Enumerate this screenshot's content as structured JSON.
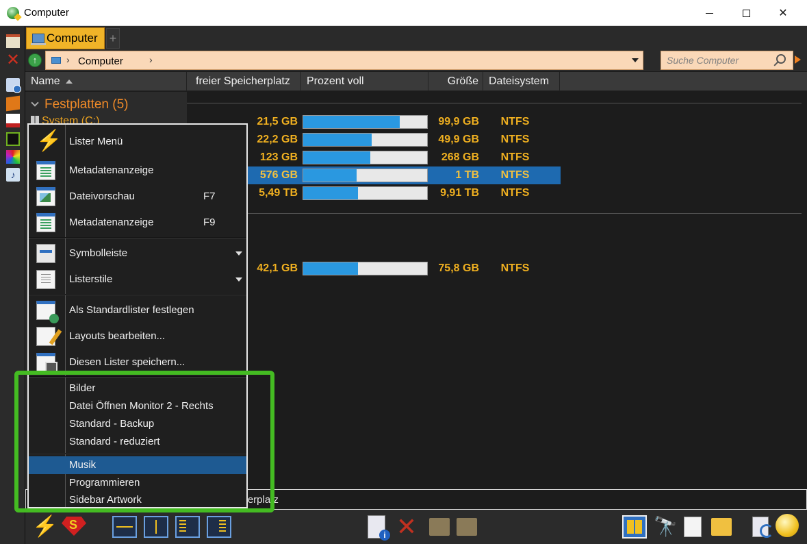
{
  "window": {
    "title": "Computer"
  },
  "tabs": [
    {
      "label": "Computer"
    }
  ],
  "location": {
    "path_item": "Computer",
    "search_placeholder": "Suche Computer"
  },
  "columns": {
    "name": "Name",
    "free": "freier Speicherplatz",
    "percent": "Prozent voll",
    "size": "Größe",
    "fs": "Dateisystem"
  },
  "group": {
    "label": "Festplatten (5)",
    "first_drive": "System (C:)"
  },
  "drives": [
    {
      "free": "21,5 GB",
      "percent_full": 0.78,
      "size": "99,9 GB",
      "fs": "NTFS",
      "selected": false
    },
    {
      "free": "22,2 GB",
      "percent_full": 0.55,
      "size": "49,9 GB",
      "fs": "NTFS",
      "selected": false
    },
    {
      "free": "123 GB",
      "percent_full": 0.54,
      "size": "268 GB",
      "fs": "NTFS",
      "selected": false
    },
    {
      "free": "576 GB",
      "percent_full": 0.43,
      "size": "1 TB",
      "fs": "NTFS",
      "selected": true
    },
    {
      "free": "5,49 TB",
      "percent_full": 0.44,
      "size": "9,91 TB",
      "fs": "NTFS",
      "selected": false
    },
    {
      "free": "42,1 GB",
      "percent_full": 0.44,
      "size": "75,8 GB",
      "fs": "NTFS",
      "selected": false
    }
  ],
  "status": {
    "text": "cherplatz"
  },
  "menu": {
    "items": [
      {
        "label": "Lister Menü",
        "icon": "lightning-icon"
      },
      {
        "label": "Metadatenanzeige",
        "icon": "metadata-icon"
      },
      {
        "label": "Dateivorschau",
        "shortcut": "F7",
        "icon": "preview-icon"
      },
      {
        "label": "Metadatenanzeige",
        "shortcut": "F9",
        "icon": "metadata-icon"
      },
      {
        "label": "Symbolleiste",
        "icon": "toolbar-icon",
        "submenu": true
      },
      {
        "label": "Listerstile",
        "icon": "lister-styles-icon",
        "submenu": true
      },
      {
        "label": "Als Standardlister festlegen",
        "icon": "set-default-icon"
      },
      {
        "label": "Layouts bearbeiten...",
        "icon": "edit-layouts-icon"
      },
      {
        "label": "Diesen Lister speichern...",
        "icon": "save-lister-icon"
      },
      {
        "label": "Bilder"
      },
      {
        "label": "Datei Öffnen Monitor 2 - Rechts"
      },
      {
        "label": "Standard - Backup"
      },
      {
        "label": "Standard - reduziert"
      },
      {
        "label": "Musik",
        "highlighted": true
      },
      {
        "label": "Programmieren"
      },
      {
        "label": "Sidebar Artwork"
      }
    ]
  },
  "colors": {
    "accent_orange": "#f08a28",
    "value_yellow": "#f0b020",
    "bar_blue": "#2a98e0",
    "selection_blue": "#1e6ab0",
    "highlight_green": "#44bb22"
  }
}
